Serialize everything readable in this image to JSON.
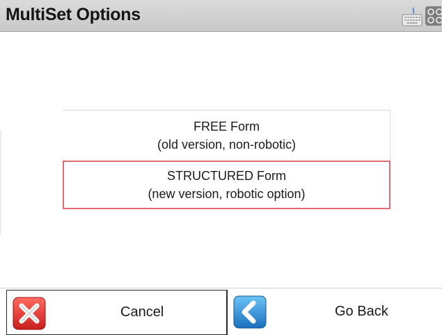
{
  "window": {
    "title": "MultiSet Options"
  },
  "header_icons": {
    "keyboard": "keyboard-icon",
    "apps": "apps-grid-icon"
  },
  "options": [
    {
      "line1": "FREE Form",
      "line2": "(old version, non-robotic)",
      "selected": false
    },
    {
      "line1": "STRUCTURED Form",
      "line2": "(new version, robotic option)",
      "selected": true
    }
  ],
  "footer": {
    "cancel_label": "Cancel",
    "cancel_icon": "red-x-icon",
    "go_back_label": "Go Back",
    "go_back_icon": "blue-chevron-left-icon"
  },
  "colors": {
    "header_bg": "#d0d0d0",
    "selected_border": "#e06c72",
    "cancel_red": "#e53935",
    "back_blue": "#2b8fd6"
  }
}
